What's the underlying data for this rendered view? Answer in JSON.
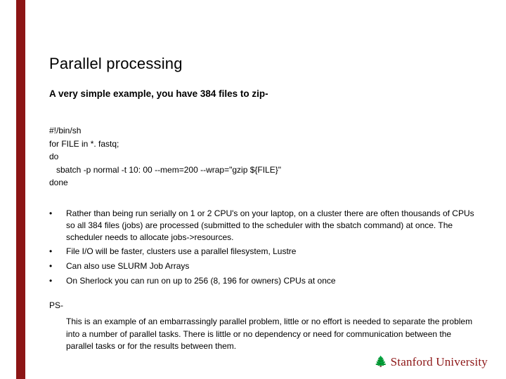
{
  "title": "Parallel processing",
  "subtitle": "A very simple example, you have 384 files to zip-",
  "code": {
    "l1": "#!/bin/sh",
    "l2": "for FILE in *. fastq;",
    "l3": "do",
    "l4": "sbatch -p normal -t 10: 00 --mem=200 --wrap=\"gzip ${FILE}\"",
    "l5": "done"
  },
  "bullets": [
    "Rather than being run serially on 1 or 2 CPU's on your laptop, on a cluster there are often thousands of CPUs so all 384 files (jobs) are processed (submitted to the scheduler with the sbatch command)  at once.  The scheduler needs to allocate jobs->resources.",
    "File I/O will be faster, clusters use a parallel filesystem, Lustre",
    "Can also use SLURM Job Arrays",
    "On Sherlock you can run on up to 256 (8, 196 for owners) CPUs at once"
  ],
  "ps": {
    "label": "PS-",
    "body": "This is an example of an embarrassingly parallel problem, little or no effort is needed to separate the problem into a number of parallel tasks. There is little or no dependency or need for communication between the parallel tasks or for the results between them."
  },
  "logo": {
    "text": "Stanford University",
    "tree": "🌲"
  },
  "bullet_char": "•"
}
